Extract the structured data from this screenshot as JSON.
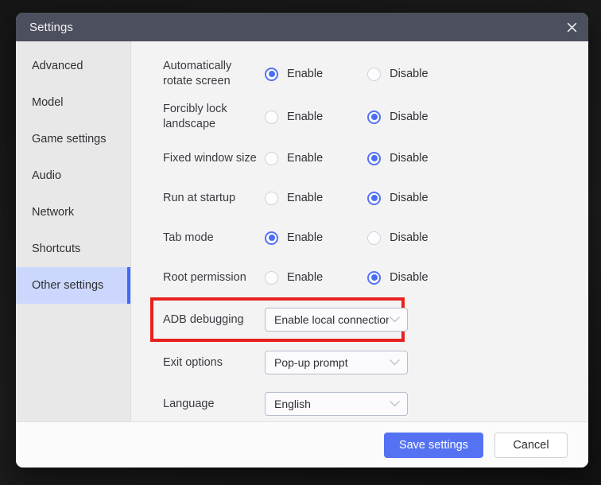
{
  "window": {
    "title": "Settings",
    "close_icon": "close-icon"
  },
  "sidebar": {
    "items": [
      {
        "label": "Advanced",
        "active": false
      },
      {
        "label": "Model",
        "active": false
      },
      {
        "label": "Game settings",
        "active": false
      },
      {
        "label": "Audio",
        "active": false
      },
      {
        "label": "Network",
        "active": false
      },
      {
        "label": "Shortcuts",
        "active": false
      },
      {
        "label": "Other settings",
        "active": true
      }
    ]
  },
  "settings": {
    "radio_rows": [
      {
        "label": "Automatically rotate screen",
        "enable_label": "Enable",
        "disable_label": "Disable",
        "selected": "enable"
      },
      {
        "label": "Forcibly lock landscape",
        "enable_label": "Enable",
        "disable_label": "Disable",
        "selected": "disable"
      },
      {
        "label": "Fixed window size",
        "enable_label": "Enable",
        "disable_label": "Disable",
        "selected": "disable"
      },
      {
        "label": "Run at startup",
        "enable_label": "Enable",
        "disable_label": "Disable",
        "selected": "disable"
      },
      {
        "label": "Tab mode",
        "enable_label": "Enable",
        "disable_label": "Disable",
        "selected": "enable"
      },
      {
        "label": "Root permission",
        "enable_label": "Enable",
        "disable_label": "Disable",
        "selected": "disable"
      }
    ],
    "adb_debugging": {
      "label": "ADB debugging",
      "value": "Enable local connection",
      "highlighted": true
    },
    "exit_options": {
      "label": "Exit options",
      "value": "Pop-up prompt"
    },
    "language": {
      "label": "Language",
      "value": "English"
    }
  },
  "footer": {
    "save_label": "Save settings",
    "cancel_label": "Cancel"
  },
  "colors": {
    "titlebar": "#4c4f5e",
    "accent_blue": "#5572f3",
    "sidebar_active_bg": "#ccd7fd",
    "sidebar_active_bar": "#4169f5",
    "highlight_red": "#e8201f",
    "content_bg": "#f3f3f4",
    "sidebar_bg": "#e8e8e8"
  }
}
